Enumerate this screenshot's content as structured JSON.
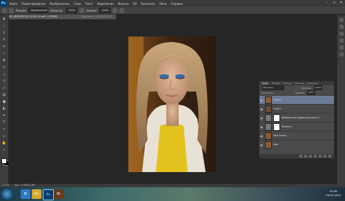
{
  "app": {
    "logo": "Ps"
  },
  "menu": [
    "Файл",
    "Редактирование",
    "Изображение",
    "Слои",
    "Текст",
    "Выделение",
    "Фильтр",
    "3D",
    "Просмотр",
    "Окно",
    "Справка"
  ],
  "window_controls": [
    "–",
    "▫",
    "✕"
  ],
  "options_bar": {
    "mode_label": "Режим:",
    "mode_value": "Нормальный",
    "opacity_label": "Непрозр.:",
    "opacity_value": "100%",
    "flow_label": "Нажим:",
    "flow_value": "100%"
  },
  "document": {
    "tab_title": "IMG_3663.JPG @ 12,6% (Слой 2, RGB/8)",
    "info": "Документ: 1,36 М/5,55 М"
  },
  "status_bar": {
    "zoom": "12,6%",
    "doc": "Док: 13,8M/41,6M"
  },
  "layers_panel": {
    "tabs": [
      "Слои",
      "Каналы",
      "Контуры",
      "История",
      "Операции"
    ],
    "active_tab": "Слои",
    "blend_mode": "Обычные",
    "opacity_label": "Непрозр.:",
    "opacity_value": "100%",
    "fill_label": "Заливка:",
    "fill_value": "100%",
    "lock_label": "Закрепить:",
    "layers": [
      {
        "name": "Слой 2",
        "selected": true,
        "has_mask": false
      },
      {
        "name": "Слой 1",
        "selected": false,
        "has_mask": false
      },
      {
        "name": "Выборочная коррекция цвета 1",
        "selected": false,
        "has_mask": true
      },
      {
        "name": "Уровни 1",
        "selected": false,
        "has_mask": true
      },
      {
        "name": "Фон копия",
        "selected": false,
        "has_mask": false
      },
      {
        "name": "Фон",
        "selected": false,
        "has_mask": false
      }
    ]
  },
  "taskbar": {
    "clock_time": "10:09",
    "clock_date": "29.01.2015",
    "apps": [
      "IE",
      "Ex",
      "Ps",
      "Br"
    ]
  },
  "colors": {
    "accent": "#6b7a95",
    "app_bg": "#262626",
    "panel": "#4a4a4a"
  }
}
